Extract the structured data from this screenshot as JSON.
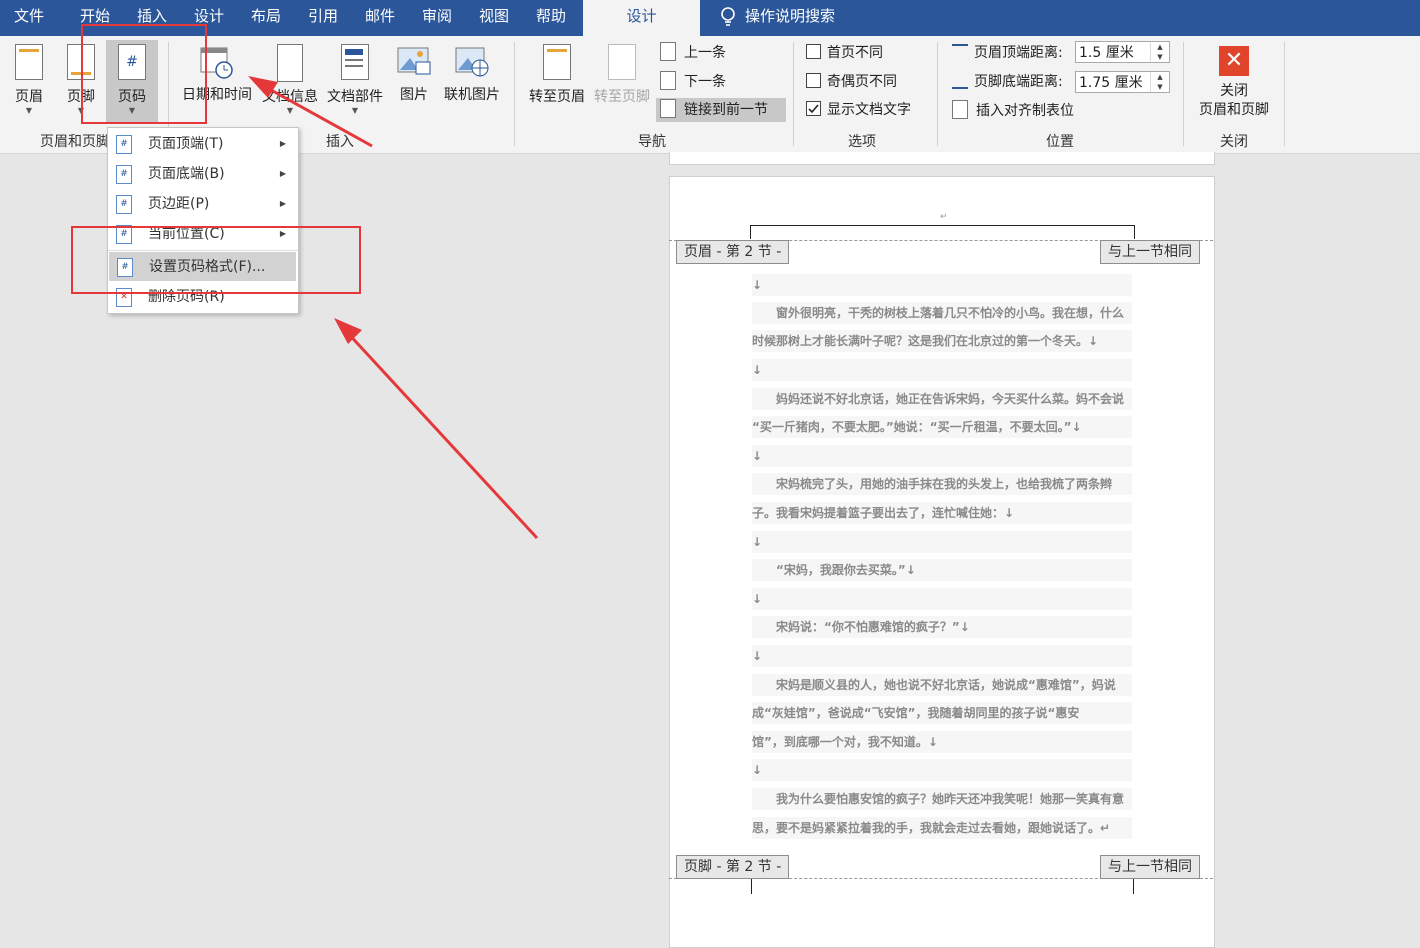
{
  "tabs": [
    "文件",
    "开始",
    "插入",
    "设计",
    "布局",
    "引用",
    "邮件",
    "审阅",
    "视图",
    "帮助",
    "设计",
    "操作说明搜索"
  ],
  "ribbon": {
    "hf_group": {
      "header": "页眉",
      "footer": "页脚",
      "pagenum": "页码",
      "label": "页眉和页脚"
    },
    "insert_group": {
      "datetime": "日期和时间",
      "docinfo": "文档信息",
      "parts": "文档部件",
      "picture": "图片",
      "online_picture": "联机图片",
      "label": "插入"
    },
    "nav_group": {
      "goto_header": "转至页眉",
      "goto_footer": "转至页脚",
      "prev": "上一条",
      "next": "下一条",
      "link_prev": "链接到前一节",
      "label": "导航"
    },
    "options_group": {
      "diff_first": "首页不同",
      "diff_odd_even": "奇偶页不同",
      "show_text": "显示文档文字",
      "label": "选项"
    },
    "position_group": {
      "header_dist_label": "页眉顶端距离:",
      "header_dist_value": "1.5 厘米",
      "footer_dist_label": "页脚底端距离:",
      "footer_dist_value": "1.75 厘米",
      "insert_tab": "插入对齐制表位",
      "label": "位置"
    },
    "close_group": {
      "close_line1": "关闭",
      "close_line2": "页眉和页脚",
      "label": "关闭"
    }
  },
  "menu": [
    "页面顶端(T)",
    "页面底端(B)",
    "页边距(P)",
    "当前位置(C)",
    "设置页码格式(F)...",
    "删除页码(R)"
  ],
  "doc": {
    "header_tag": "页眉 - 第 2 节 -",
    "footer_tag": "页脚 - 第 2 节 -",
    "same_as_prev": "与上一节相同",
    "lines": [
      "↓",
      "　　窗外很明亮，干秃的树枝上落着几只不怕冷的小鸟。我在想，什么",
      "时候那树上才能长满叶子呢？这是我们在北京过的第一个冬天。↓",
      "↓",
      "　　妈妈还说不好北京话，她正在告诉宋妈，今天买什么菜。妈不会说",
      "“买一斤猪肉，不要太肥。”她说：“买一斤租温，不要太回。”↓",
      "↓",
      "　　宋妈梳完了头，用她的油手抹在我的头发上，也给我梳了两条辫",
      "子。我看宋妈提着篮子要出去了，连忙喊住她：↓",
      "↓",
      "　　“宋妈，我跟你去买菜。”↓",
      "↓",
      "　　宋妈说：“你不怕惠难馆的疯子？”↓",
      "↓",
      "　　宋妈是顺义县的人，她也说不好北京话，她说成“惠难馆”，妈说",
      "成“灰娃馆”，爸说成“飞安馆”，我随着胡同里的孩子说“惠安",
      "馆”，到底哪一个对，我不知道。↓",
      "↓",
      "　　我为什么要怕惠安馆的疯子？她昨天还冲我笑呢！她那一笑真有意",
      "思，要不是妈紧紧拉着我的手，我就会走过去看她，跟她说话了。↵"
    ]
  }
}
